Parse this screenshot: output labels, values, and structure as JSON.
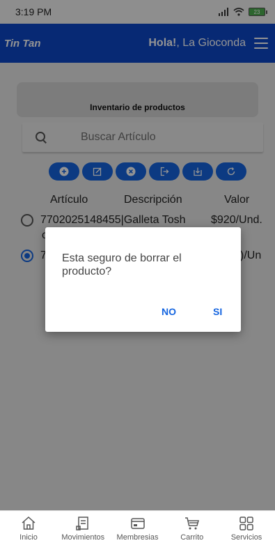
{
  "status_bar": {
    "time": "3:19 PM",
    "battery_level": "23"
  },
  "app_bar": {
    "brand": "Tin Tan",
    "greeting_bold": "Hola!",
    "greeting_rest": ", La Gioconda"
  },
  "inventory": {
    "title": "Inventario de productos"
  },
  "search": {
    "placeholder": "Buscar Artículo"
  },
  "toolbar": {
    "icons": [
      "plus-circle-icon",
      "edit-icon",
      "close-circle-icon",
      "export-icon",
      "download-icon",
      "refresh-icon"
    ]
  },
  "table": {
    "headers": {
      "article": "Artículo",
      "description": "Descripción",
      "value": "Valor"
    },
    "rows": [
      {
        "text": "7702025148455|Galleta Tosh",
        "sub": "c",
        "value": "$920/Und.",
        "selected": false
      },
      {
        "text": "7",
        "value": ")/Un",
        "selected": true
      }
    ]
  },
  "dialog": {
    "message": "Esta seguro de borrar el producto?",
    "no_label": "NO",
    "yes_label": "SI"
  },
  "bottom_nav": [
    {
      "label": "Inicio",
      "icon": "home-icon"
    },
    {
      "label": "Movimientos",
      "icon": "receipt-icon"
    },
    {
      "label": "Membresias",
      "icon": "card-icon"
    },
    {
      "label": "Carrito",
      "icon": "cart-icon"
    },
    {
      "label": "Servicios",
      "icon": "grid-icon"
    }
  ],
  "colors": {
    "primary": "#0d47c9",
    "accent": "#1565e0",
    "background": "#e9e9e9"
  }
}
